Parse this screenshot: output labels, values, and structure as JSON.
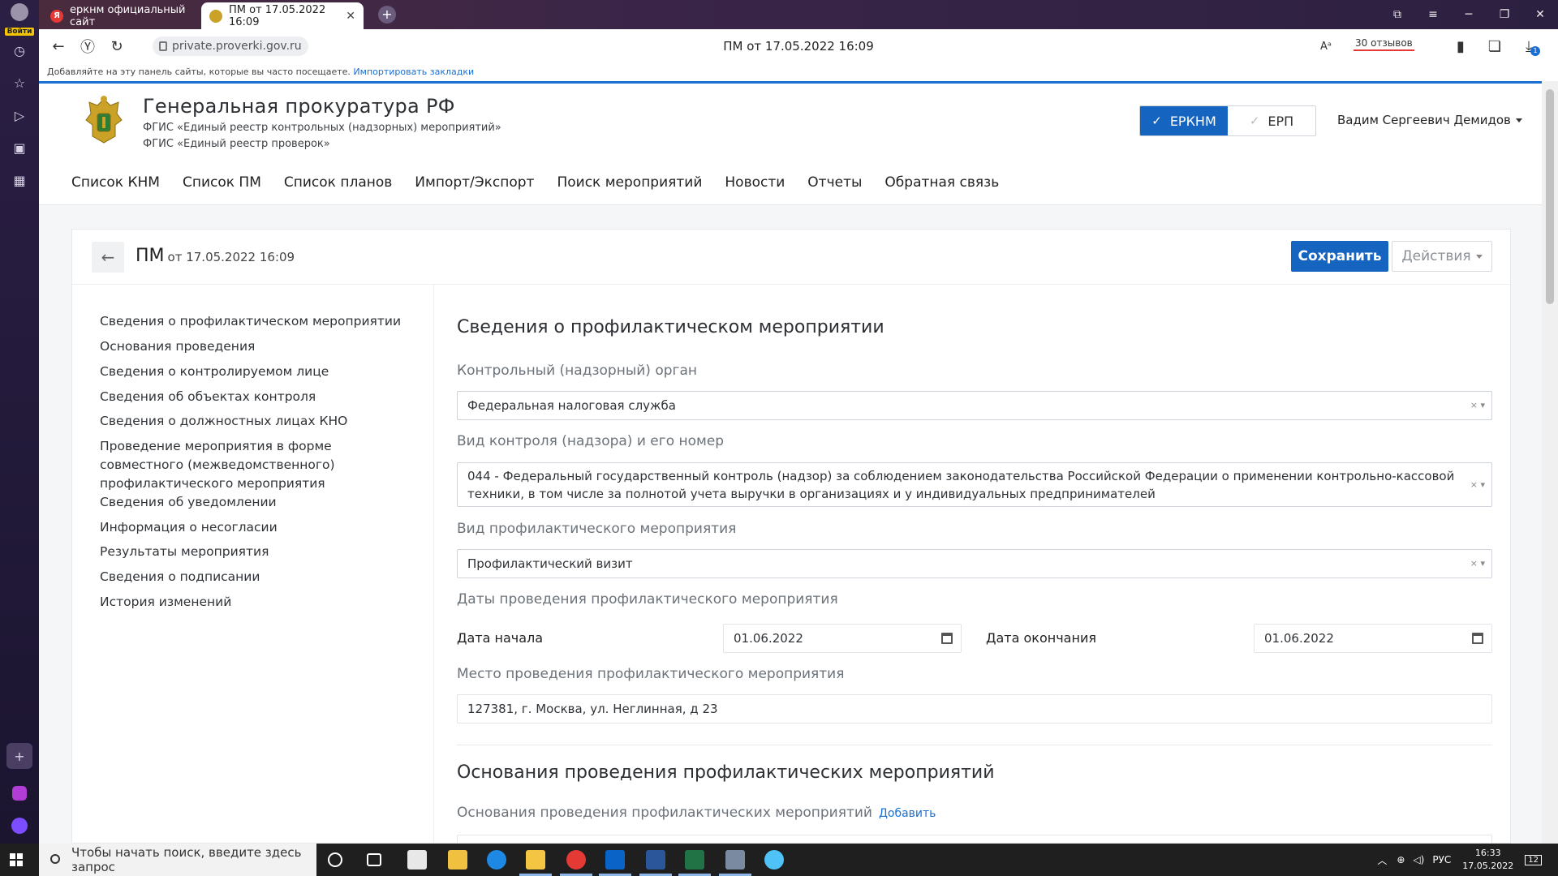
{
  "browser": {
    "login_label": "Войти",
    "tabs": [
      {
        "title": "еркнм официальный сайт"
      },
      {
        "title": "ПМ от 17.05.2022 16:09"
      }
    ],
    "address": "private.proverki.gov.ru",
    "page_title": "ПМ от 17.05.2022 16:09",
    "reviews": "30 отзывов",
    "bookmarks_hint": "Добавляйте на эту панель сайты, которые вы часто посещаете.",
    "bookmarks_import": "Импортировать закладки",
    "download_badge": "1"
  },
  "site": {
    "org_title": "Генеральная прокуратура РФ",
    "org_sub_1": "ФГИС «Единый реестр контрольных (надзорных) мероприятий»",
    "org_sub_2": "ФГИС «Единый реестр проверок»",
    "systems": {
      "active": "ЕРКНМ",
      "inactive": "ЕРП"
    },
    "user": "Вадим Сергеевич Демидов",
    "nav": [
      "Список КНМ",
      "Список ПМ",
      "Список планов",
      "Импорт/Экспорт",
      "Поиск мероприятий",
      "Новости",
      "Отчеты",
      "Обратная связь"
    ]
  },
  "record": {
    "title": "ПМ",
    "date": "от 17.05.2022 16:09",
    "save_label": "Сохранить",
    "actions_label": "Действия"
  },
  "sidebar": {
    "items": [
      {
        "label": "Сведения о профилактическом мероприятии"
      },
      {
        "label": "Основания проведения"
      },
      {
        "label": "Сведения о контролируемом лице"
      },
      {
        "label": "Сведения об объектах контроля"
      },
      {
        "label": "Сведения о должностных лицах КНО"
      },
      {
        "label": "Проведение мероприятия в форме совместного (межведомственного) профилактического мероприятия"
      },
      {
        "label": "Сведения об уведомлении"
      },
      {
        "label": "Информация о несогласии"
      },
      {
        "label": "Результаты мероприятия"
      },
      {
        "label": "Сведения о подписании"
      },
      {
        "label": "История изменений"
      }
    ]
  },
  "form": {
    "section_1_title": "Сведения о профилактическом мероприятии",
    "control_body": {
      "label": "Контрольный (надзорный) орган",
      "value": "Федеральная налоговая служба"
    },
    "control_type": {
      "label": "Вид контроля (надзора) и его номер",
      "value": "044 - Федеральный государственный контроль (надзор) за соблюдением законодательства Российской Федерации о применении контрольно-кассовой техники, в том числе за полнотой учета выручки в организациях и у индивидуальных предпринимателей"
    },
    "event_type": {
      "label": "Вид профилактического мероприятия",
      "value": "Профилактический визит"
    },
    "dates": {
      "label": "Даты проведения профилактического мероприятия",
      "start_label": "Дата начала",
      "start_value": "01.06.2022",
      "end_label": "Дата окончания",
      "end_value": "01.06.2022"
    },
    "place": {
      "label": "Место проведения профилактического мероприятия",
      "value": "127381, г. Москва, ул. Неглинная, д 23"
    },
    "section_2_title": "Основания проведения профилактических мероприятий",
    "grounds": {
      "label": "Основания проведения профилактических мероприятий",
      "add_label": "Добавить"
    }
  },
  "taskbar": {
    "search_placeholder": "Чтобы начать поиск, введите здесь запрос",
    "lang": "РУС",
    "time": "16:33",
    "date": "17.05.2022",
    "notifications": "12"
  }
}
